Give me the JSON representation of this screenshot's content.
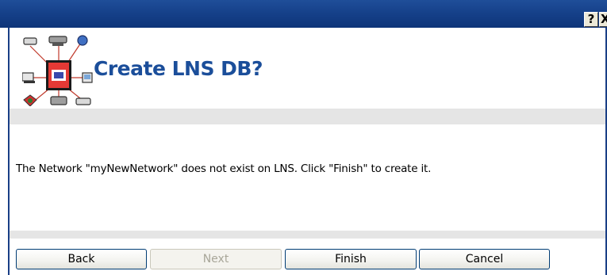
{
  "titlebar": {
    "help_label": "?",
    "close_label": "X"
  },
  "header": {
    "title": "Create LNS DB?"
  },
  "message": "The Network \"myNewNetwork\" does not exist on LNS. Click \"Finish\" to create it.",
  "buttons": {
    "back": "Back",
    "next": "Next",
    "finish": "Finish",
    "cancel": "Cancel"
  },
  "colors": {
    "titlebar": "#16418a",
    "title_text": "#1b4e9a",
    "band": "#e5e5e5",
    "button_border": "#003c74"
  },
  "icons": {
    "header": "network-topology-icon"
  }
}
